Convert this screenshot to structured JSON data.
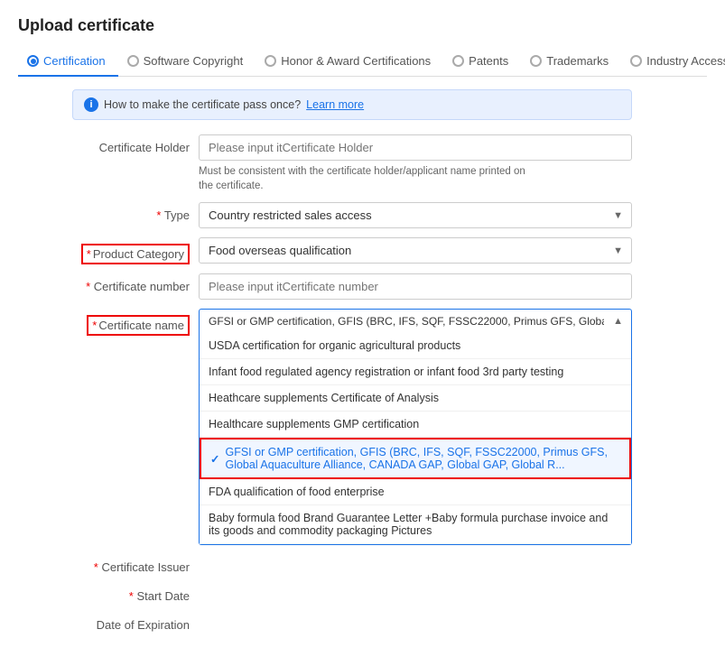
{
  "page": {
    "title": "Upload certificate"
  },
  "tabs": [
    {
      "id": "certification",
      "label": "Certification",
      "active": true
    },
    {
      "id": "software-copyright",
      "label": "Software Copyright",
      "active": false
    },
    {
      "id": "honor-award",
      "label": "Honor & Award Certifications",
      "active": false
    },
    {
      "id": "patents",
      "label": "Patents",
      "active": false
    },
    {
      "id": "trademarks",
      "label": "Trademarks",
      "active": false
    },
    {
      "id": "industry-access",
      "label": "Industry Access Qualification",
      "active": false
    }
  ],
  "info_banner": {
    "text": "How to make the certificate pass once?",
    "link_text": "Learn more"
  },
  "form": {
    "certificate_holder_label": "Certificate Holder",
    "certificate_holder_placeholder": "Please input itCertificate Holder",
    "certificate_holder_helper": "Must be consistent with the certificate holder/applicant name printed on\nthe certificate.",
    "type_label": "Type",
    "type_value": "Country restricted sales access",
    "product_category_label": "Product Category",
    "product_category_value": "Food overseas qualification",
    "certificate_number_label": "Certificate number",
    "certificate_number_placeholder": "Please input itCertificate number",
    "certificate_name_label": "Certificate name",
    "certificate_name_value": "GFSI or GMP certification, GFIS (BRC, IFS, SQF, FSSC22000, Primus GFS, Global Aquaculture Alliance, CANADA GAP, Global GAP, Global Red",
    "dropdown_items": [
      {
        "id": "usda",
        "text": "USDA certification for organic agricultural products",
        "selected": false
      },
      {
        "id": "infant-food",
        "text": "Infant food regulated agency registration or infant food 3rd party testing",
        "selected": false
      },
      {
        "id": "healthcare-coa",
        "text": "Heathcare supplements Certificate of Analysis",
        "selected": false
      },
      {
        "id": "healthcare-gmp",
        "text": "Healthcare supplements GMP certification",
        "selected": false
      },
      {
        "id": "gfsi-gmp",
        "text": "GFSI or GMP certification, GFIS (BRC, IFS, SQF, FSSC22000, Primus GFS, Global Aquaculture Alliance, CANADA GAP, Global GAP, Global R...",
        "selected": true
      },
      {
        "id": "fda",
        "text": "FDA qualification of food enterprise",
        "selected": false
      },
      {
        "id": "baby-formula",
        "text": "Baby formula food Brand Guarantee Letter +Baby formula purchase invoice and its goods and commodity packaging Pictures",
        "selected": false
      }
    ],
    "certificate_issuer_label": "Certificate Issuer",
    "start_date_label": "Start Date",
    "date_of_expiration_label": "Date of Expiration"
  }
}
